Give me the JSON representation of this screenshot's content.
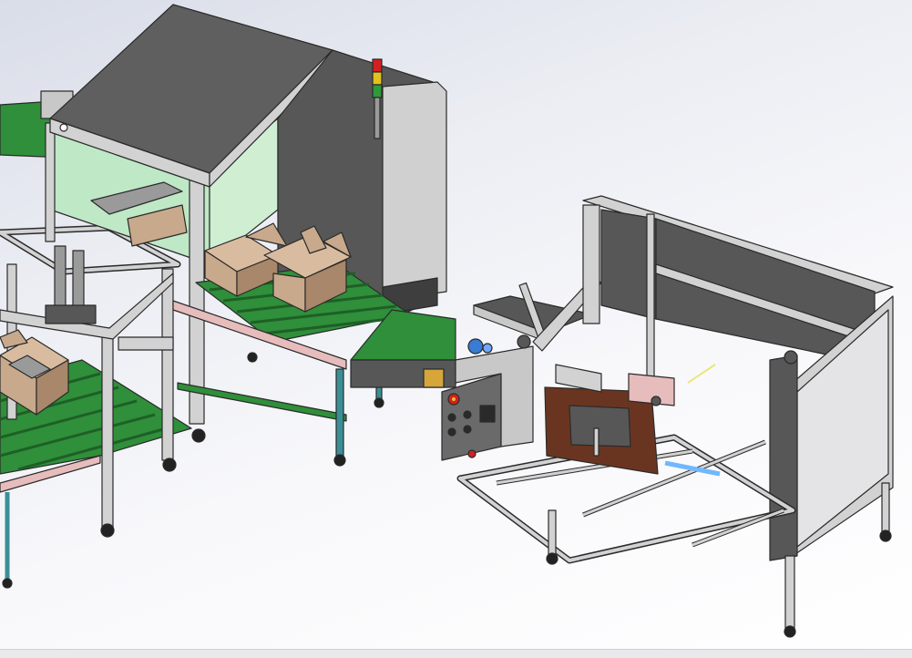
{
  "app": {
    "view": "isometric-3d-model",
    "background": "gradient"
  },
  "colors": {
    "frame": "#d2d2d2",
    "frame_edge": "#2a2a2a",
    "panel_dark": "#575757",
    "panel_light": "#c8c8c8",
    "conveyor": "#2f8f3a",
    "conveyor_dark": "#1f5f27",
    "carton": "#c8a98c",
    "carton_dark": "#a8876a",
    "glass": "#bfe8c6",
    "brown": "#6a3520",
    "pink": "#e7bcbc",
    "teal": "#3a8f96",
    "light_red": "#d42020",
    "light_yellow": "#e2c21c",
    "light_green": "#2f9a3a"
  },
  "icons": [
    "signal-tower-icon",
    "estop-button-icon",
    "control-knob-icon"
  ]
}
